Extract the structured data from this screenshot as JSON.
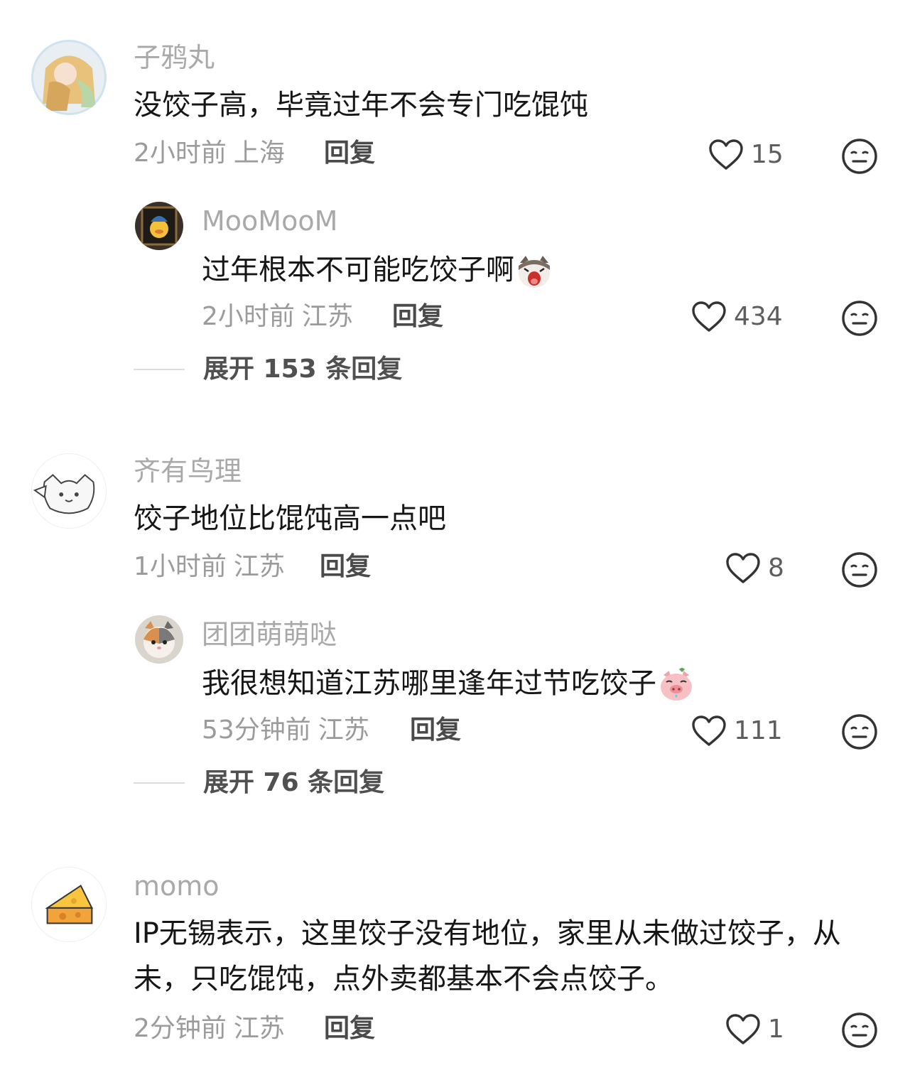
{
  "comments": [
    {
      "username": "子鸦丸",
      "content": "没饺子高，毕竟过年不会专门吃馄饨",
      "time": "2小时前",
      "location": "上海",
      "reply": "回复",
      "likes": "15",
      "replies": [
        {
          "username": "MooMooM",
          "content": "过年根本不可能吃饺子啊",
          "emoji": "crying-cat-emoji",
          "time": "2小时前",
          "location": "江苏",
          "reply": "回复",
          "likes": "434"
        }
      ],
      "expand": "展开 153 条回复"
    },
    {
      "username": "齐有鸟理",
      "content": "饺子地位比馄饨高一点吧",
      "time": "1小时前",
      "location": "江苏",
      "reply": "回复",
      "likes": "8",
      "replies": [
        {
          "username": "团团萌萌哒",
          "content": "我很想知道江苏哪里逢年过节吃饺子",
          "emoji": "pig-emoji",
          "time": "53分钟前",
          "location": "江苏",
          "reply": "回复",
          "likes": "111"
        }
      ],
      "expand": "展开 76 条回复"
    },
    {
      "username": "momo",
      "content": "IP无锡表示，这里饺子没有地位，家里从未做过饺子，从未，只吃馄饨，点外卖都基本不会点饺子。",
      "time": "2分钟前",
      "location": "江苏",
      "reply": "回复",
      "likes": "1"
    }
  ],
  "icons": {
    "like": "heart-outline-icon",
    "dislike": "neutral-face-icon"
  },
  "colors": {
    "username": "#a9a9a9",
    "meta": "#9b9b9b",
    "text": "#161616"
  }
}
